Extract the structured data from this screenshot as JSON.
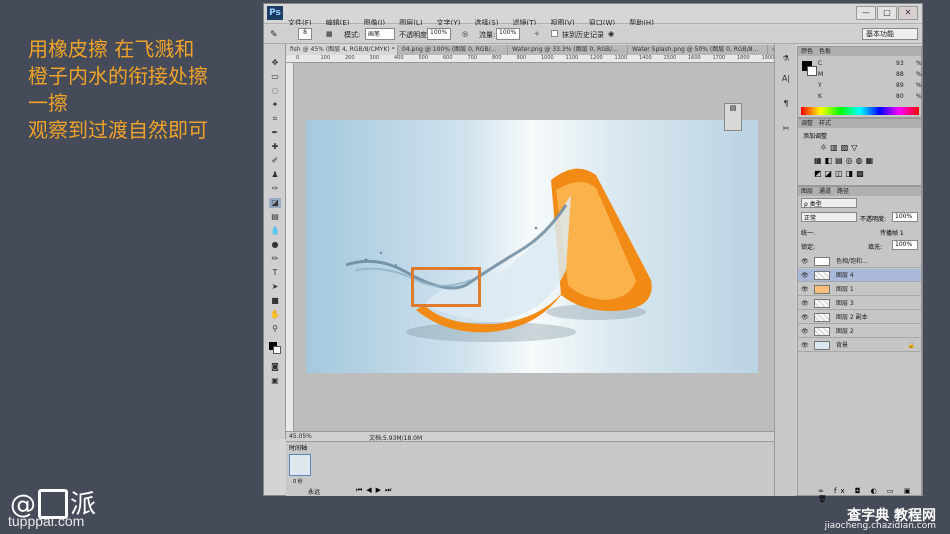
{
  "instruction": [
    "用橡皮擦 在飞溅和",
    "橙子内水的衔接处擦",
    "一擦",
    "观察到过渡自然即可"
  ],
  "brand": {
    "logo_prefix": "@",
    "logo_text": "图",
    "logo_suffix": "派",
    "site": "tupppai.com"
  },
  "watermark": {
    "title": "查字典 教程网",
    "url": "jiaocheng.chazidian.com"
  },
  "ps": {
    "logo": "Ps",
    "menu": [
      "文件(F)",
      "编辑(E)",
      "图像(I)",
      "图层(L)",
      "文字(Y)",
      "选择(S)",
      "滤镜(T)",
      "视图(V)",
      "窗口(W)",
      "帮助(H)"
    ],
    "window_controls": [
      "—",
      "□",
      "✕"
    ],
    "options": {
      "size": "8",
      "mode_label": "模式:",
      "mode_value": "画笔",
      "opacity_label": "不透明度:",
      "opacity_value": "100%",
      "flow_label": "流量:",
      "flow_value": "100%",
      "history_label": "抹到历史记录",
      "workspace": "基本功能"
    },
    "tabs": [
      "fish @ 45% (图层 4, RGB/8/CMYK) *",
      "04.png @ 100% (图层 0, RGB/...",
      "Water.png @ 33.3% (图层 0, RGB/...",
      "Water Splash.png @ 50% (图层 0, RGB/8..."
    ],
    "ruler_h": [
      "0",
      "100",
      "200",
      "300",
      "400",
      "500",
      "600",
      "700",
      "800",
      "900",
      "1000",
      "1100",
      "1200",
      "1300",
      "1400",
      "1500",
      "1600",
      "1700",
      "1800",
      "1900"
    ],
    "status": {
      "zoom": "45.05%",
      "doc": "文档:5.93M/18.0M"
    },
    "timeline": {
      "title": "时间轴",
      "frame_time": "0 秒",
      "loop": "永远"
    }
  },
  "panels": {
    "color_tabs": [
      "颜色",
      "色板"
    ],
    "cmyk": [
      {
        "label": "C",
        "value": "93",
        "unit": "%"
      },
      {
        "label": "M",
        "value": "88",
        "unit": "%"
      },
      {
        "label": "Y",
        "value": "89",
        "unit": "%"
      },
      {
        "label": "K",
        "value": "80",
        "unit": "%"
      }
    ],
    "adjust_tabs": [
      "调整",
      "样式"
    ],
    "adjust_title": "添加调整",
    "layers_tabs": [
      "图层",
      "通道",
      "路径"
    ],
    "kind": "ρ 类型",
    "blend": "正常",
    "opacity_label": "不透明度:",
    "opacity": "100%",
    "lock_label": "锁定:",
    "fill_label": "填充:",
    "fill": "100%",
    "unify_label": "统一:",
    "propagate_label": "传播帧 1",
    "layers": [
      {
        "name": "色相/饱和...",
        "kind": "adjust"
      },
      {
        "name": "图层 4",
        "kind": "normal",
        "selected": true
      },
      {
        "name": "图层 1",
        "kind": "normal"
      },
      {
        "name": "图层 3",
        "kind": "normal"
      },
      {
        "name": "图层 2 副本",
        "kind": "normal"
      },
      {
        "name": "图层 2",
        "kind": "normal"
      },
      {
        "name": "背景",
        "kind": "bg"
      }
    ]
  },
  "colors": {
    "accent": "#f0a32a",
    "highlight": "#e07a2c",
    "selection": "#a9b9d7"
  }
}
